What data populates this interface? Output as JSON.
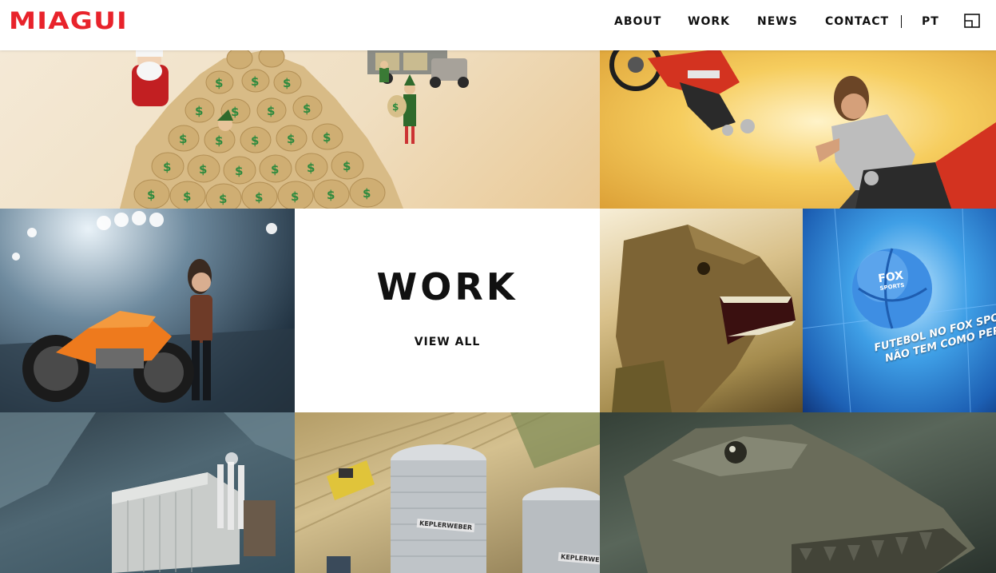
{
  "header": {
    "logo_text": "MIAGUI",
    "nav": {
      "about": "ABOUT",
      "work": "WORK",
      "news": "NEWS",
      "contact": "CONTACT",
      "language": "PT"
    },
    "layout_icon": "layout-grid-icon"
  },
  "main": {
    "work_section": {
      "title": "WORK",
      "view_all": "VIEW ALL"
    },
    "tiles": {
      "fox": {
        "badge_main": "FOX",
        "badge_sub": "SPORTS",
        "caption_line1": "FUTEBOL NO FOX SPO",
        "caption_line2": "NÃO TEM COMO PER"
      },
      "silo": {
        "brand_1": "KEPLERWEBER",
        "brand_2": "KEPLERWEBER"
      }
    }
  },
  "colors": {
    "brand_red": "#e8232b",
    "text": "#111111",
    "background": "#ffffff"
  }
}
